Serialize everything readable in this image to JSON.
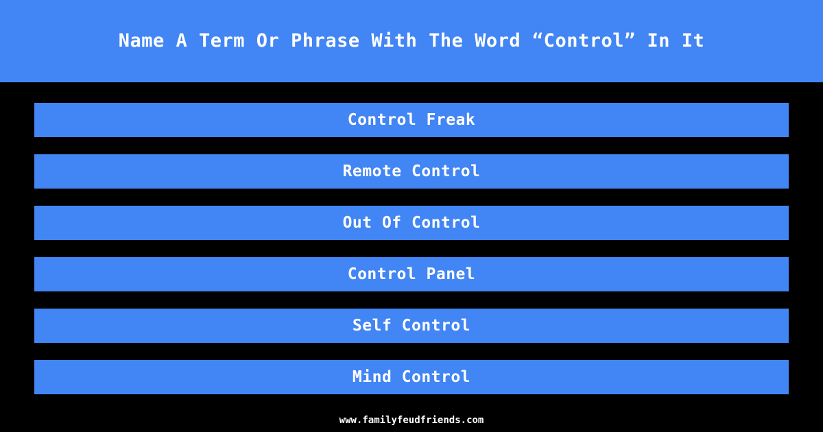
{
  "theme": {
    "background_color": "#000000",
    "accent_color": "#4285f4",
    "text_color": "#ffffff"
  },
  "header": {
    "title": "Name A Term Or Phrase With The Word “Control” In It"
  },
  "answers": [
    {
      "rank": 1,
      "text": "Control Freak"
    },
    {
      "rank": 2,
      "text": "Remote Control"
    },
    {
      "rank": 3,
      "text": "Out Of Control"
    },
    {
      "rank": 4,
      "text": "Control Panel"
    },
    {
      "rank": 5,
      "text": "Self Control"
    },
    {
      "rank": 6,
      "text": "Mind Control"
    }
  ],
  "footer": {
    "url": "www.familyfeudfriends.com"
  }
}
